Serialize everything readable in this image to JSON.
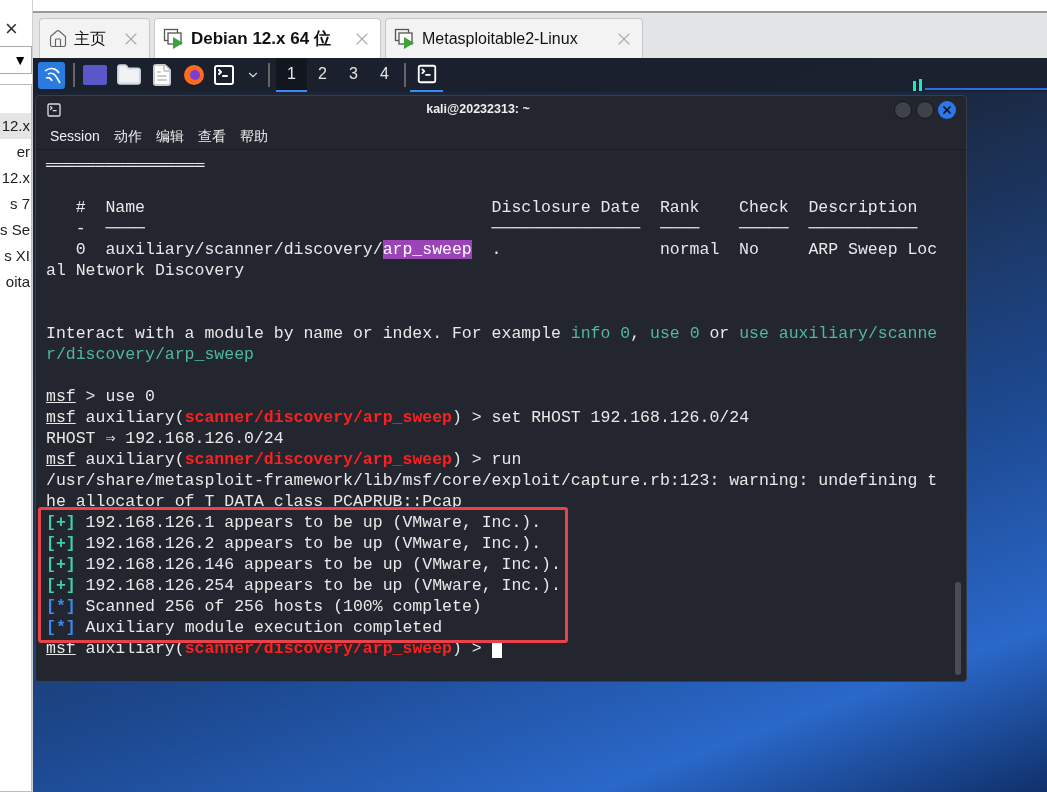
{
  "sidebar": {
    "close_glyph": "×",
    "dropdown_glyph": "▼",
    "items": [
      {
        "label": "12.x",
        "selected": true
      },
      {
        "label": "er",
        "selected": false
      },
      {
        "label": "12.x",
        "selected": false
      },
      {
        "label": "s 7",
        "selected": false
      },
      {
        "label": "s Se",
        "selected": false
      },
      {
        "label": "s XI",
        "selected": false
      },
      {
        "label": "oita",
        "selected": false
      }
    ]
  },
  "tabs": [
    {
      "kind": "home",
      "label": "主页",
      "selected": false
    },
    {
      "kind": "vm",
      "label": "Debian 12.x 64 位",
      "selected": true
    },
    {
      "kind": "vm",
      "label": "Metasploitable2-Linux",
      "selected": false
    }
  ],
  "panel": {
    "workspaces": [
      {
        "label": "1",
        "selected": true
      },
      {
        "label": "2",
        "selected": false
      },
      {
        "label": "3",
        "selected": false
      },
      {
        "label": "4",
        "selected": false
      }
    ],
    "tasks": [
      {
        "active": true
      }
    ]
  },
  "terminal": {
    "title": "kali@20232313: ~",
    "menu": [
      "Session",
      "动作",
      "编辑",
      "查看",
      "帮助"
    ],
    "cursor_visible": true,
    "blocks": [
      {
        "boxed": false,
        "lines": [
          {
            "kind": "text",
            "segments": [
              {
                "text": "════════════════",
                "kind": "plain"
              }
            ]
          },
          {
            "kind": "blank"
          },
          {
            "kind": "text",
            "segments": [
              {
                "text": "   #  Name                                   Disclosure Date  Rank    Check  Description",
                "kind": "plain"
              }
            ]
          },
          {
            "kind": "text",
            "segments": [
              {
                "text": "   -  ────                                   ───────────────  ────    ─────  ───────────",
                "kind": "plain"
              }
            ]
          },
          {
            "kind": "text",
            "segments": [
              {
                "text": "   0  auxiliary/scanner/discovery/",
                "kind": "plain"
              },
              {
                "text": "arp_sweep",
                "kind": "match"
              },
              {
                "text": "  .                normal  No     ARP Sweep Loc",
                "kind": "plain"
              }
            ]
          },
          {
            "kind": "text",
            "segments": [
              {
                "text": "al Network Discovery",
                "kind": "plain"
              }
            ]
          },
          {
            "kind": "blank"
          },
          {
            "kind": "blank"
          },
          {
            "kind": "text",
            "segments": [
              {
                "text": "Interact with a module by name or index. For example ",
                "kind": "plain"
              },
              {
                "text": "info 0",
                "kind": "hint"
              },
              {
                "text": ", ",
                "kind": "plain"
              },
              {
                "text": "use 0",
                "kind": "hint"
              },
              {
                "text": " or ",
                "kind": "plain"
              },
              {
                "text": "use auxiliary/scanne",
                "kind": "hint"
              }
            ]
          },
          {
            "kind": "text",
            "segments": [
              {
                "text": "r/discovery/arp_sweep",
                "kind": "hint"
              }
            ]
          },
          {
            "kind": "blank"
          },
          {
            "kind": "text",
            "segments": [
              {
                "text": "msf",
                "kind": "prompt"
              },
              {
                "text": " > use 0",
                "kind": "plain"
              }
            ]
          },
          {
            "kind": "text",
            "segments": [
              {
                "text": "msf",
                "kind": "prompt"
              },
              {
                "text": " auxiliary(",
                "kind": "plain"
              },
              {
                "text": "scanner/discovery/arp_sweep",
                "kind": "module"
              },
              {
                "text": ") > set RHOST 192.168.126.0/24",
                "kind": "plain"
              }
            ]
          },
          {
            "kind": "text",
            "segments": [
              {
                "text": "RHOST ⇒ 192.168.126.0/24",
                "kind": "plain"
              }
            ]
          },
          {
            "kind": "text",
            "segments": [
              {
                "text": "msf",
                "kind": "prompt"
              },
              {
                "text": " auxiliary(",
                "kind": "plain"
              },
              {
                "text": "scanner/discovery/arp_sweep",
                "kind": "module"
              },
              {
                "text": ") > run",
                "kind": "plain"
              }
            ]
          },
          {
            "kind": "text",
            "segments": [
              {
                "text": "/usr/share/metasploit-framework/lib/msf/core/exploit/capture.rb:123: warning: undefining t",
                "kind": "plain"
              }
            ]
          },
          {
            "kind": "text",
            "segments": [
              {
                "text": "he allocator of T_DATA class PCAPRUB::Pcap",
                "kind": "plain"
              }
            ]
          }
        ]
      },
      {
        "boxed": true,
        "lines": [
          {
            "kind": "text",
            "segments": [
              {
                "text": "[+]",
                "kind": "good"
              },
              {
                "text": " 192.168.126.1 appears to be up (VMware, Inc.).",
                "kind": "plain"
              }
            ]
          },
          {
            "kind": "text",
            "segments": [
              {
                "text": "[+]",
                "kind": "good"
              },
              {
                "text": " 192.168.126.2 appears to be up (VMware, Inc.).",
                "kind": "plain"
              }
            ]
          },
          {
            "kind": "text",
            "segments": [
              {
                "text": "[+]",
                "kind": "good"
              },
              {
                "text": " 192.168.126.146 appears to be up (VMware, Inc.).",
                "kind": "plain"
              }
            ]
          },
          {
            "kind": "text",
            "segments": [
              {
                "text": "[+]",
                "kind": "good"
              },
              {
                "text": " 192.168.126.254 appears to be up (VMware, Inc.).",
                "kind": "plain"
              }
            ]
          },
          {
            "kind": "text",
            "segments": [
              {
                "text": "[*]",
                "kind": "info"
              },
              {
                "text": " Scanned 256 of 256 hosts (100% complete)",
                "kind": "plain"
              }
            ]
          },
          {
            "kind": "text",
            "segments": [
              {
                "text": "[*]",
                "kind": "info"
              },
              {
                "text": " Auxiliary module execution completed",
                "kind": "plain"
              }
            ]
          }
        ]
      },
      {
        "boxed": false,
        "lines": [
          {
            "kind": "text",
            "segments": [
              {
                "text": "msf",
                "kind": "prompt"
              },
              {
                "text": " auxiliary(",
                "kind": "plain"
              },
              {
                "text": "scanner/discovery/arp_sweep",
                "kind": "module"
              },
              {
                "text": ") > ",
                "kind": "plain"
              }
            ]
          }
        ]
      }
    ]
  }
}
